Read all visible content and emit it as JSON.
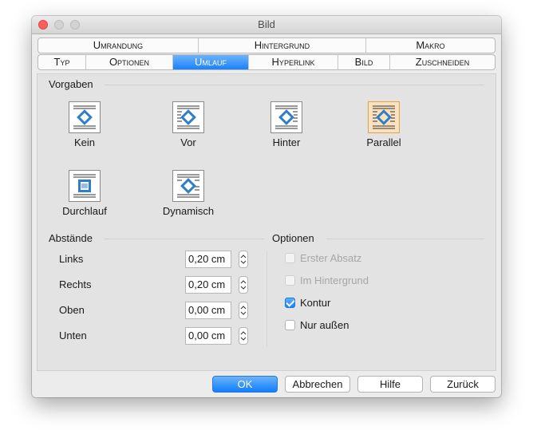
{
  "window": {
    "title": "Bild"
  },
  "tabs_row1": [
    "Umrandung",
    "Hintergrund",
    "Makro"
  ],
  "tabs_row2": [
    "Typ",
    "Optionen",
    "Umlauf",
    "Hyperlink",
    "Bild",
    "Zuschneiden"
  ],
  "active_tab": "Umlauf",
  "vorgaben": {
    "label": "Vorgaben",
    "items": [
      {
        "label": "Kein",
        "icon": "wrap-none-icon"
      },
      {
        "label": "Vor",
        "icon": "wrap-before-icon"
      },
      {
        "label": "Hinter",
        "icon": "wrap-after-icon"
      },
      {
        "label": "Parallel",
        "icon": "wrap-parallel-icon",
        "selected": true
      },
      {
        "label": "Durchlauf",
        "icon": "wrap-through-icon"
      },
      {
        "label": "Dynamisch",
        "icon": "wrap-optimal-icon"
      }
    ]
  },
  "abstaende": {
    "label": "Abstände",
    "fields": [
      {
        "label": "Links",
        "value": "0,20 cm"
      },
      {
        "label": "Rechts",
        "value": "0,20 cm"
      },
      {
        "label": "Oben",
        "value": "0,00 cm"
      },
      {
        "label": "Unten",
        "value": "0,00 cm"
      }
    ]
  },
  "optionen": {
    "label": "Optionen",
    "checkboxes": [
      {
        "label": "Erster Absatz",
        "checked": false,
        "disabled": true
      },
      {
        "label": "Im Hintergrund",
        "checked": false,
        "disabled": true
      },
      {
        "label": "Kontur",
        "checked": true,
        "disabled": false
      },
      {
        "label": "Nur außen",
        "checked": false,
        "disabled": false
      }
    ]
  },
  "buttons": {
    "ok": "OK",
    "cancel": "Abbrechen",
    "help": "Hilfe",
    "reset": "Zurück"
  },
  "colors": {
    "accent": "#1a82fb",
    "selected_preset": "#fbe1bd",
    "close": "#fc605c"
  }
}
